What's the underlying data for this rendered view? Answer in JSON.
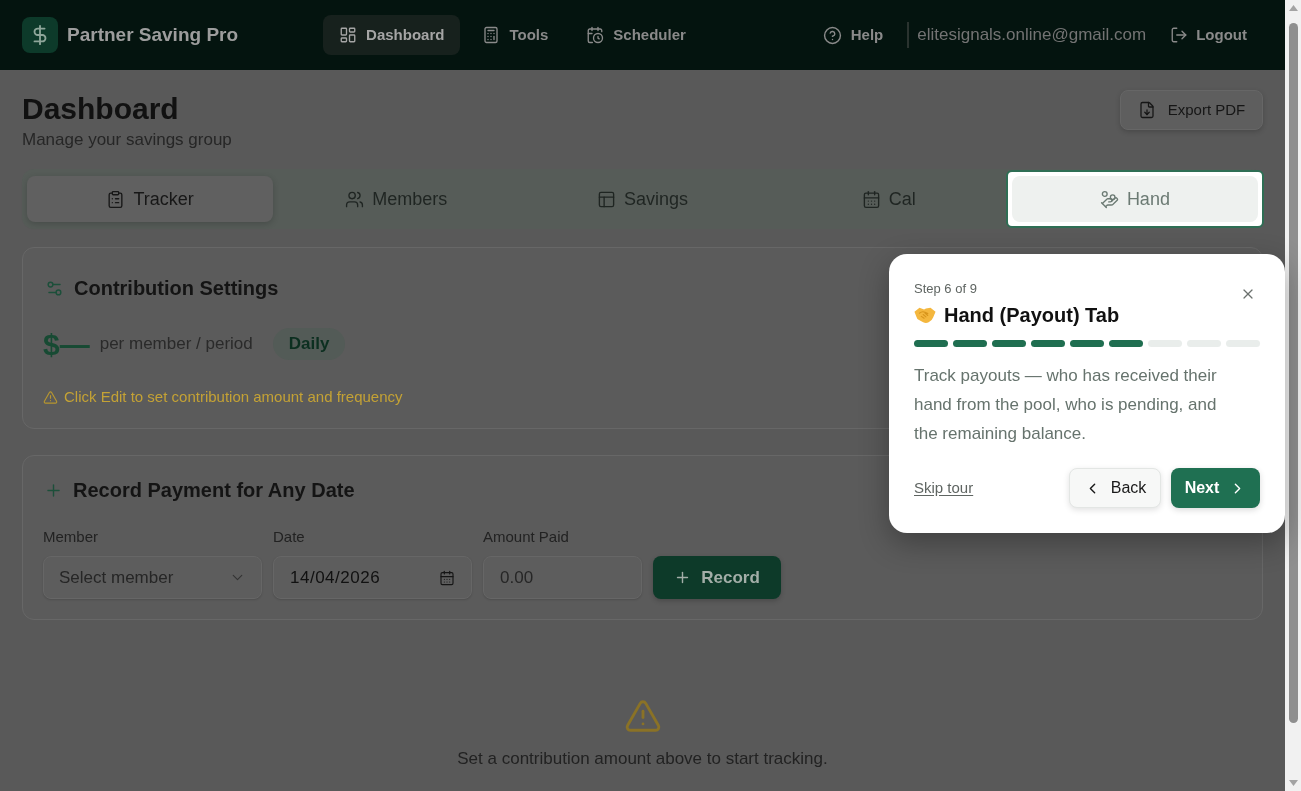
{
  "header": {
    "brand": "Partner Saving Pro",
    "nav": [
      {
        "label": "Dashboard",
        "selected": true
      },
      {
        "label": "Tools",
        "selected": false
      },
      {
        "label": "Scheduler",
        "selected": false
      }
    ],
    "help": "Help",
    "email": "elitesignals.online@gmail.com",
    "logout": "Logout"
  },
  "page": {
    "title": "Dashboard",
    "subtitle": "Manage your savings group",
    "export_button": "Export PDF"
  },
  "tabs": [
    {
      "label": "Tracker",
      "selected": true,
      "spotlight": false
    },
    {
      "label": "Members",
      "selected": false,
      "spotlight": false
    },
    {
      "label": "Savings",
      "selected": false,
      "spotlight": false
    },
    {
      "label": "Cal",
      "selected": false,
      "spotlight": false
    },
    {
      "label": "Hand",
      "selected": false,
      "spotlight": true
    }
  ],
  "contribution_settings": {
    "title": "Contribution Settings",
    "amount": "$—",
    "per": "per member / period",
    "frequency": "Daily",
    "warning": "Click Edit to set contribution amount and frequency"
  },
  "record_payment": {
    "title": "Record Payment for Any Date",
    "fields": [
      {
        "label": "Member",
        "kind": "select",
        "placeholder": "Select member"
      },
      {
        "label": "Date",
        "kind": "date",
        "value": "14/04/2026"
      },
      {
        "label": "Amount Paid",
        "kind": "number",
        "placeholder": "0.00"
      }
    ],
    "button": "Record"
  },
  "empty_state": {
    "message": "Set a contribution amount above to start tracking."
  },
  "tour": {
    "step": "Step 6 of 9",
    "title": "Hand (Payout) Tab",
    "progress": [
      {
        "filled": true
      },
      {
        "filled": true
      },
      {
        "filled": true
      },
      {
        "filled": true
      },
      {
        "filled": true
      },
      {
        "filled": true
      },
      {
        "filled": false
      },
      {
        "filled": false
      },
      {
        "filled": false
      }
    ],
    "body": "Track payouts — who has received their hand from the pool, who is pending, and the remaining balance.",
    "skip": "Skip tour",
    "back": "Back",
    "next": "Next"
  }
}
